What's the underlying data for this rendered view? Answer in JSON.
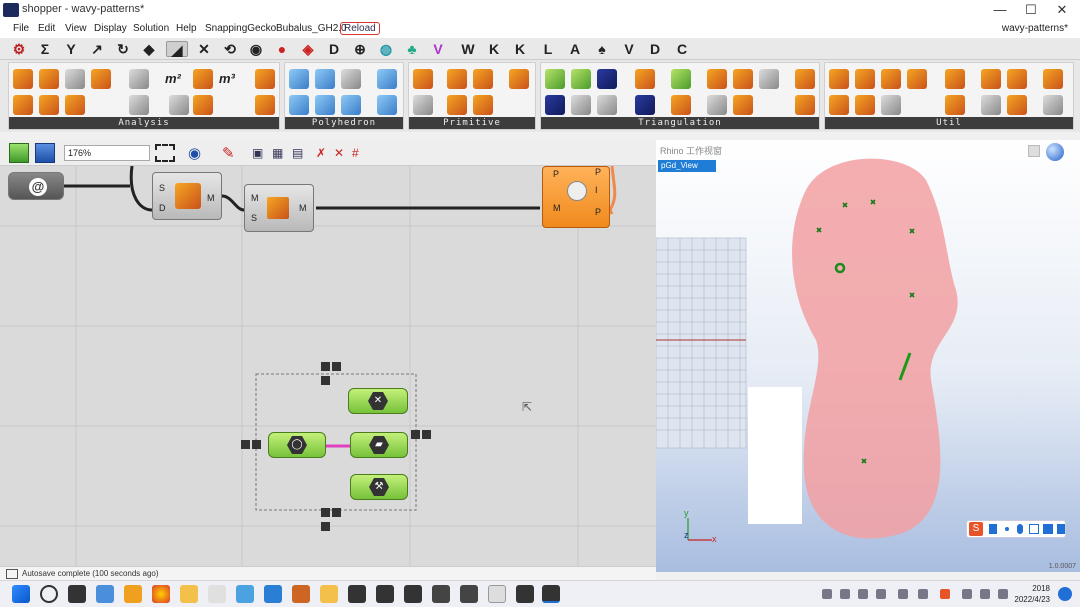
{
  "window": {
    "title": "shopper - wavy-patterns*",
    "minimize": "—",
    "maximize": "☐",
    "close": "✕"
  },
  "menu": {
    "items": [
      "File",
      "Edit",
      "View",
      "Display",
      "Solution",
      "Help",
      "SnappingGecko",
      "Bubalus_GH2.0",
      "Reload"
    ],
    "doc_name": "wavy-patterns*"
  },
  "tabs": {
    "letters": [
      "W",
      "K",
      "K",
      "L",
      "A",
      "V",
      "D",
      "C"
    ],
    "symbols": [
      "Σ",
      "⊕",
      "D"
    ]
  },
  "ribbon": {
    "panels": [
      "Analysis",
      "Polyhedron",
      "Primitive",
      "Triangulation",
      "Util"
    ],
    "m2": "m²",
    "m3": "m³"
  },
  "canvas": {
    "zoom": "176%",
    "components": {
      "comp1_ports_in": [
        "S",
        "D"
      ],
      "comp1_port_out": "M",
      "comp2_ports_in": [
        "M",
        "S"
      ],
      "comp2_port_out": "M",
      "comp3_ports_in": [
        "P",
        "M"
      ],
      "comp3_ports_out": [
        "P",
        "I",
        "P"
      ]
    },
    "status": "Autosave complete (100 seconds ago)"
  },
  "viewport": {
    "title": "Rhino 工作视窗",
    "tab": "pGd_View",
    "axis_y": "y",
    "axis_z": "z",
    "axis_x": "x",
    "version": "1.0.0007"
  },
  "taskbar": {
    "time": "2018",
    "date": "2022/4/23"
  }
}
